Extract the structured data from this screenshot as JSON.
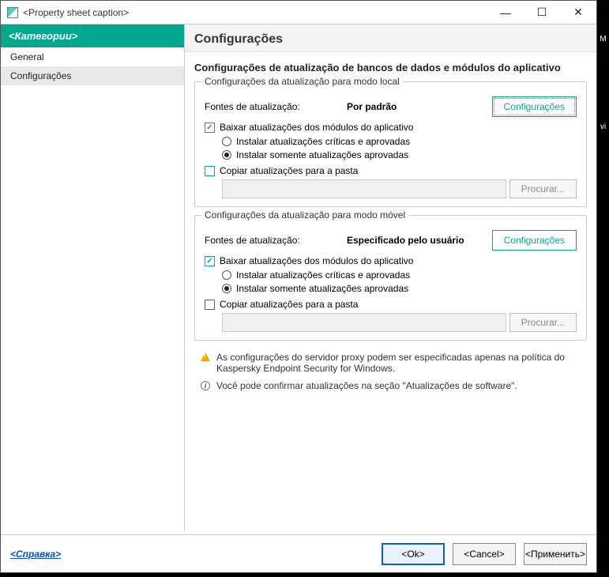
{
  "window": {
    "title": "<Property sheet caption>"
  },
  "sidebar": {
    "header": "<Категории>",
    "items": [
      "General",
      "Configurações"
    ]
  },
  "content": {
    "header": "Configurações",
    "section_title": "Configurações de atualização de bancos de dados e módulos do aplicativo",
    "local": {
      "legend": "Configurações da atualização para modo local",
      "sources_label": "Fontes de atualização:",
      "sources_value": "Por padrão",
      "config_button": "Configurações",
      "download_modules": "Baixar atualizações dos módulos do aplicativo",
      "radio_critical": "Instalar atualizações críticas e aprovadas",
      "radio_approved": "Instalar somente atualizações aprovadas",
      "copy_to_folder": "Copiar atualizações para a pasta",
      "browse": "Procurar..."
    },
    "mobile": {
      "legend": "Configurações da atualização para modo móvel",
      "sources_label": "Fontes de atualização:",
      "sources_value": "Especificado pelo usuário",
      "config_button": "Configurações",
      "download_modules": "Baixar atualizações dos módulos do aplicativo",
      "radio_critical": "Instalar atualizações críticas e aprovadas",
      "radio_approved": "Instalar somente atualizações aprovadas",
      "copy_to_folder": "Copiar atualizações para a pasta",
      "browse": "Procurar..."
    },
    "warning": "As configurações do servidor proxy podem ser especificadas apenas na política do Kaspersky Endpoint Security for Windows.",
    "info": "Você pode confirmar atualizações na seção \"Atualizações de software\"."
  },
  "footer": {
    "help": "<Справка>",
    "ok": "<Ok>",
    "cancel": "<Cancel>",
    "apply": "<Применить>"
  },
  "strip": {
    "m": "M",
    "v": "vi"
  }
}
